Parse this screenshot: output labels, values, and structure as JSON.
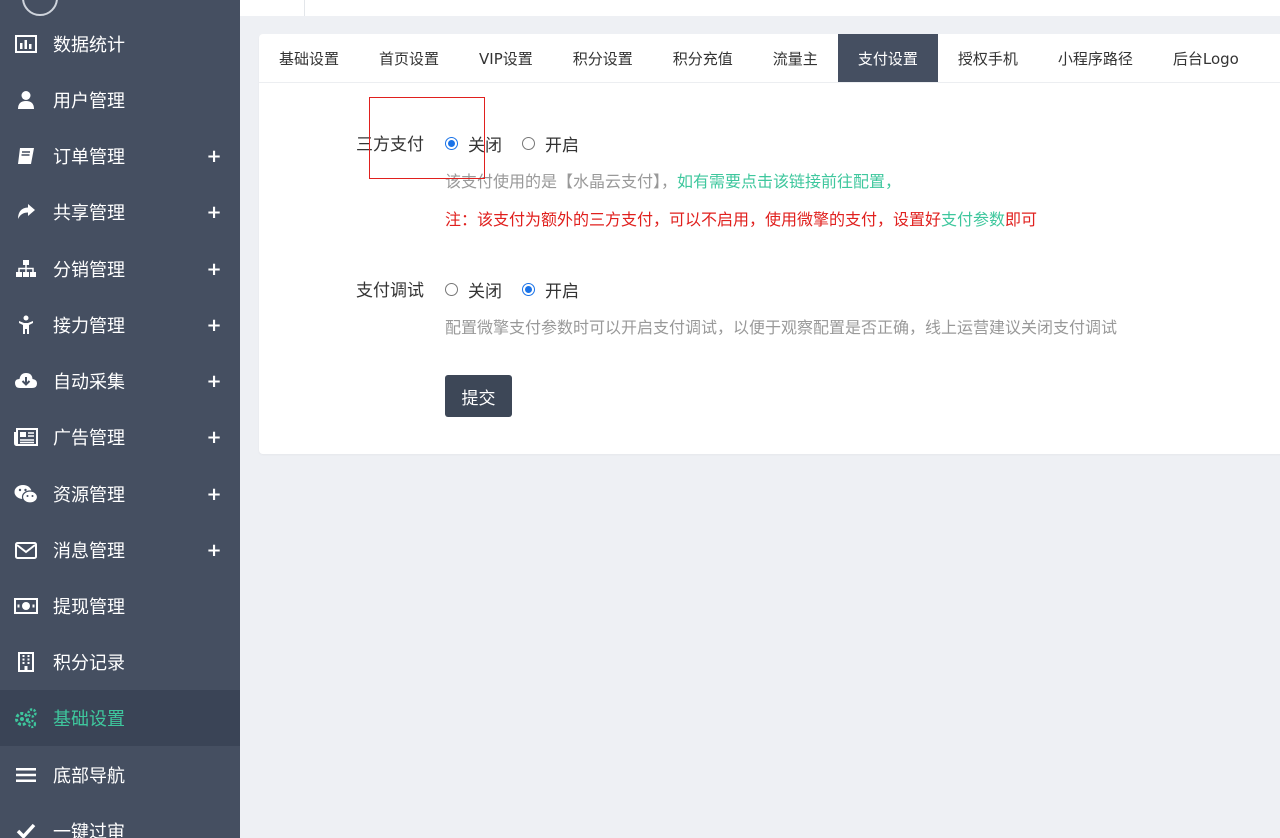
{
  "sidebar": {
    "items": [
      {
        "label": "数据统计",
        "icon": "bar-chart-icon",
        "plus": false
      },
      {
        "label": "用户管理",
        "icon": "user-icon",
        "plus": false
      },
      {
        "label": "订单管理",
        "icon": "book-icon",
        "plus": true
      },
      {
        "label": "共享管理",
        "icon": "share-icon",
        "plus": true
      },
      {
        "label": "分销管理",
        "icon": "sitemap-icon",
        "plus": true
      },
      {
        "label": "接力管理",
        "icon": "person-icon",
        "plus": true
      },
      {
        "label": "自动采集",
        "icon": "cloud-download-icon",
        "plus": true
      },
      {
        "label": "广告管理",
        "icon": "newspaper-icon",
        "plus": true
      },
      {
        "label": "资源管理",
        "icon": "wechat-icon",
        "plus": true
      },
      {
        "label": "消息管理",
        "icon": "envelope-icon",
        "plus": true
      },
      {
        "label": "提现管理",
        "icon": "money-icon",
        "plus": false
      },
      {
        "label": "积分记录",
        "icon": "building-icon",
        "plus": false
      },
      {
        "label": "基础设置",
        "icon": "gears-icon",
        "plus": false,
        "active": true
      },
      {
        "label": "底部导航",
        "icon": "bars-icon",
        "plus": false
      },
      {
        "label": "一键过审",
        "icon": "check-icon",
        "plus": false
      }
    ],
    "plus_symbol": "+"
  },
  "tabs": [
    "基础设置",
    "首页设置",
    "VIP设置",
    "积分设置",
    "积分充值",
    "流量主",
    "支付设置",
    "授权手机",
    "小程序路径",
    "后台Logo"
  ],
  "active_tab": "支付设置",
  "form": {
    "third_pay": {
      "label": "三方支付",
      "off": "关闭",
      "on": "开启",
      "selected": "关闭",
      "help_prefix": "该支付使用的是【水晶云支付】，",
      "help_link": "如有需要点击该链接前往配置，",
      "warn_prefix": "注：该支付为额外的三方支付，可以不启用，使用微擎的支付，设置好",
      "warn_link": "支付参数",
      "warn_suffix": "即可"
    },
    "pay_debug": {
      "label": "支付调试",
      "off": "关闭",
      "on": "开启",
      "selected": "开启",
      "help": "配置微擎支付参数时可以开启支付调试，以便于观察配置是否正确，线上运营建议关闭支付调试"
    },
    "submit": "提交"
  },
  "colors": {
    "sidebar": "#454f61",
    "active": "#3ec79d",
    "link": "#3ec79d",
    "warn": "#e0201e",
    "radio": "#1a73e8"
  }
}
